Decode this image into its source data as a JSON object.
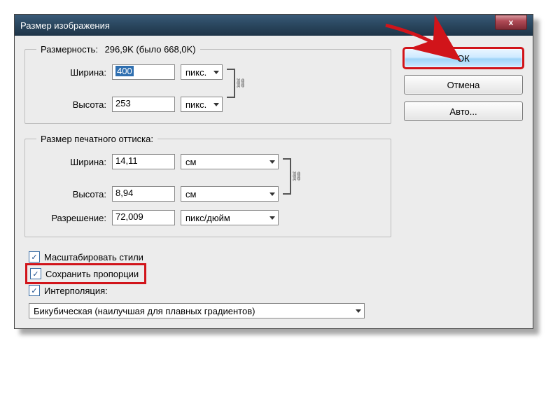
{
  "title": "Размер изображения",
  "dimensions": {
    "legend": "Размерность:",
    "summary": "296,9K (было 668,0K)",
    "width_label": "Ширина:",
    "width_value": "400",
    "width_unit": "пикс.",
    "height_label": "Высота:",
    "height_value": "253",
    "height_unit": "пикс."
  },
  "print": {
    "legend": "Размер печатного оттиска:",
    "width_label": "Ширина:",
    "width_value": "14,11",
    "width_unit": "см",
    "height_label": "Высота:",
    "height_value": "8,94",
    "height_unit": "см",
    "res_label": "Разрешение:",
    "res_value": "72,009",
    "res_unit": "пикс/дюйм"
  },
  "checks": {
    "scale_styles": "Масштабировать стили",
    "constrain": "Сохранить пропорции",
    "interpolation_label": "Интерполяция:"
  },
  "interpolation_option": "Бикубическая (наилучшая для плавных градиентов)",
  "buttons": {
    "ok": "ОК",
    "cancel": "Отмена",
    "auto": "Авто..."
  }
}
